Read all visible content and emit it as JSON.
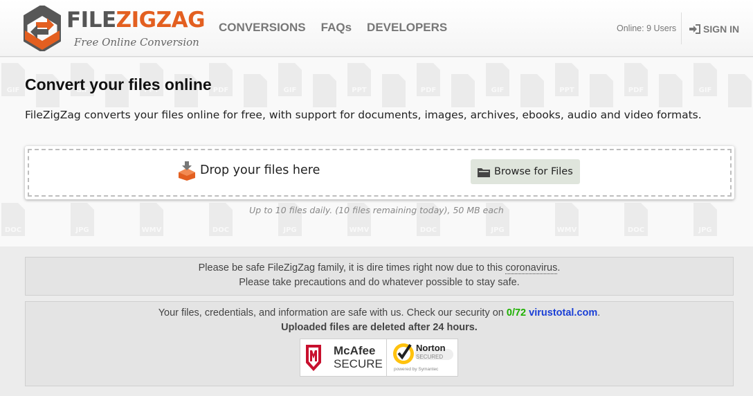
{
  "brand": {
    "name_part1": "FILE",
    "name_part2": "ZIGZAG",
    "tagline": "Free Online Conversion",
    "accent_color": "#e35f20",
    "logo_icon": "zigzag-hexagon-logo"
  },
  "nav": {
    "items": [
      {
        "label": "CONVERSIONS"
      },
      {
        "label": "FAQs"
      },
      {
        "label": "DEVELOPERS"
      }
    ],
    "online_users": "Online: 9 Users",
    "sign_in_label": "SIGN IN",
    "sign_in_icon": "sign-in-icon"
  },
  "hero": {
    "title": "Convert your files online",
    "description": "FileZigZag converts your files online for free, with support for documents, images, archives, ebooks, audio and video formats.",
    "drop_label": "Drop your files here",
    "drop_icon": "download-box-icon",
    "browse_label": "Browse for Files",
    "browse_icon": "folder-icon",
    "limits": "Up to 10 files daily. (10 files remaining today), 50 MB each",
    "pattern_top": [
      "GIF",
      "GIF",
      "PPT",
      "PDF",
      "GIF",
      "PPT",
      "PDF",
      "GIF",
      "PPT",
      "PDF",
      "GIF",
      "PPT",
      "GIF"
    ],
    "pattern_bottom": [
      "DOC",
      "JPG",
      "WMV",
      "DOC",
      "JPG",
      "WMV",
      "DOC",
      "JPG",
      "WMV",
      "DOC",
      "JPG"
    ]
  },
  "notices": {
    "covid_line1_a": "Please be safe FileZigZag family, it is dire times right now due to this ",
    "covid_link": "coronavirus",
    "covid_line1_b": ".",
    "covid_line2": "Please take precautions and do whatever possible to stay safe.",
    "security_text": "Your files, credentials, and information are safe with us. Check our security on ",
    "security_score": "0/72",
    "security_link": "virustotal.com",
    "security_end": ".",
    "deleted_text": "Uploaded files are deleted after 24 hours.",
    "mcafee_line1": "McAfee",
    "mcafee_line2": "SECURE",
    "norton_line1": "Norton",
    "norton_line2": "SECURED",
    "norton_line3": "powered by Symantec"
  }
}
